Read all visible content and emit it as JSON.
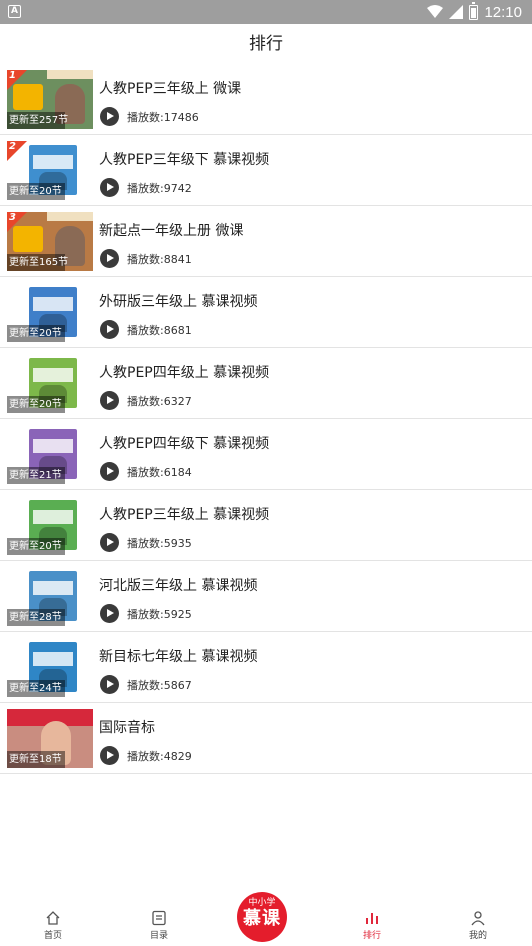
{
  "status_bar": {
    "time": "12:10",
    "notification_glyph": "A"
  },
  "header": {
    "title": "排行"
  },
  "list": [
    {
      "rank": "1",
      "title": "人教PEP三年级上 微课",
      "updated": "更新至257节",
      "plays": "播放数:17486",
      "thumb_style": "banner",
      "thumb_color": "#6d8f5f"
    },
    {
      "rank": "2",
      "title": "人教PEP三年级下 慕课视频",
      "updated": "更新至20节",
      "plays": "播放数:9742",
      "thumb_style": "box",
      "thumb_color": "#3f8fcf"
    },
    {
      "rank": "3",
      "title": "新起点一年级上册 微课",
      "updated": "更新至165节",
      "plays": "播放数:8841",
      "thumb_style": "banner",
      "thumb_color": "#b97a45"
    },
    {
      "rank": "",
      "title": "外研版三年级上 慕课视频",
      "updated": "更新至20节",
      "plays": "播放数:8681",
      "thumb_style": "box",
      "thumb_color": "#3f7fc9"
    },
    {
      "rank": "",
      "title": "人教PEP四年级上 慕课视频",
      "updated": "更新至20节",
      "plays": "播放数:6327",
      "thumb_style": "box",
      "thumb_color": "#7db84a"
    },
    {
      "rank": "",
      "title": "人教PEP四年级下 慕课视频",
      "updated": "更新至21节",
      "plays": "播放数:6184",
      "thumb_style": "box",
      "thumb_color": "#8a64b8"
    },
    {
      "rank": "",
      "title": "人教PEP三年级上 慕课视频",
      "updated": "更新至20节",
      "plays": "播放数:5935",
      "thumb_style": "box",
      "thumb_color": "#5aae52"
    },
    {
      "rank": "",
      "title": "河北版三年级上 慕课视频",
      "updated": "更新至28节",
      "plays": "播放数:5925",
      "thumb_style": "box",
      "thumb_color": "#4a90c8"
    },
    {
      "rank": "",
      "title": "新目标七年级上 慕课视频",
      "updated": "更新至24节",
      "plays": "播放数:5867",
      "thumb_style": "box",
      "thumb_color": "#2f86c6"
    },
    {
      "rank": "",
      "title": "国际音标",
      "updated": "更新至18节",
      "plays": "播放数:4829",
      "thumb_style": "photo",
      "thumb_color": "#c98d80"
    }
  ],
  "bottom_nav": {
    "home": "首页",
    "catalog": "目录",
    "center_small": "中小学",
    "center_big": "慕课",
    "rank": "排行",
    "mine": "我的"
  },
  "accent_color": "#e41d2c"
}
